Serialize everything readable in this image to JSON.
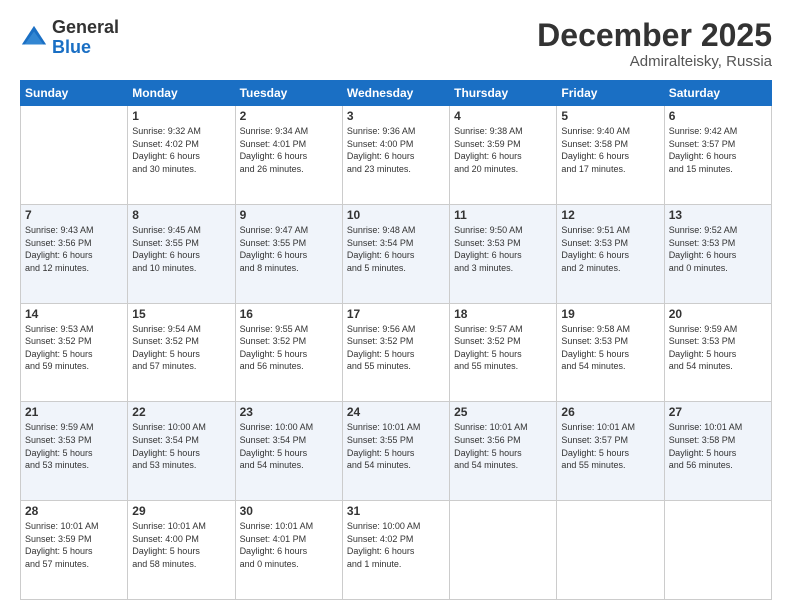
{
  "header": {
    "logo_general": "General",
    "logo_blue": "Blue",
    "month": "December 2025",
    "location": "Admiralteisky, Russia"
  },
  "days_of_week": [
    "Sunday",
    "Monday",
    "Tuesday",
    "Wednesday",
    "Thursday",
    "Friday",
    "Saturday"
  ],
  "weeks": [
    [
      {
        "day": "",
        "text": ""
      },
      {
        "day": "1",
        "text": "Sunrise: 9:32 AM\nSunset: 4:02 PM\nDaylight: 6 hours\nand 30 minutes."
      },
      {
        "day": "2",
        "text": "Sunrise: 9:34 AM\nSunset: 4:01 PM\nDaylight: 6 hours\nand 26 minutes."
      },
      {
        "day": "3",
        "text": "Sunrise: 9:36 AM\nSunset: 4:00 PM\nDaylight: 6 hours\nand 23 minutes."
      },
      {
        "day": "4",
        "text": "Sunrise: 9:38 AM\nSunset: 3:59 PM\nDaylight: 6 hours\nand 20 minutes."
      },
      {
        "day": "5",
        "text": "Sunrise: 9:40 AM\nSunset: 3:58 PM\nDaylight: 6 hours\nand 17 minutes."
      },
      {
        "day": "6",
        "text": "Sunrise: 9:42 AM\nSunset: 3:57 PM\nDaylight: 6 hours\nand 15 minutes."
      }
    ],
    [
      {
        "day": "7",
        "text": "Sunrise: 9:43 AM\nSunset: 3:56 PM\nDaylight: 6 hours\nand 12 minutes."
      },
      {
        "day": "8",
        "text": "Sunrise: 9:45 AM\nSunset: 3:55 PM\nDaylight: 6 hours\nand 10 minutes."
      },
      {
        "day": "9",
        "text": "Sunrise: 9:47 AM\nSunset: 3:55 PM\nDaylight: 6 hours\nand 8 minutes."
      },
      {
        "day": "10",
        "text": "Sunrise: 9:48 AM\nSunset: 3:54 PM\nDaylight: 6 hours\nand 5 minutes."
      },
      {
        "day": "11",
        "text": "Sunrise: 9:50 AM\nSunset: 3:53 PM\nDaylight: 6 hours\nand 3 minutes."
      },
      {
        "day": "12",
        "text": "Sunrise: 9:51 AM\nSunset: 3:53 PM\nDaylight: 6 hours\nand 2 minutes."
      },
      {
        "day": "13",
        "text": "Sunrise: 9:52 AM\nSunset: 3:53 PM\nDaylight: 6 hours\nand 0 minutes."
      }
    ],
    [
      {
        "day": "14",
        "text": "Sunrise: 9:53 AM\nSunset: 3:52 PM\nDaylight: 5 hours\nand 59 minutes."
      },
      {
        "day": "15",
        "text": "Sunrise: 9:54 AM\nSunset: 3:52 PM\nDaylight: 5 hours\nand 57 minutes."
      },
      {
        "day": "16",
        "text": "Sunrise: 9:55 AM\nSunset: 3:52 PM\nDaylight: 5 hours\nand 56 minutes."
      },
      {
        "day": "17",
        "text": "Sunrise: 9:56 AM\nSunset: 3:52 PM\nDaylight: 5 hours\nand 55 minutes."
      },
      {
        "day": "18",
        "text": "Sunrise: 9:57 AM\nSunset: 3:52 PM\nDaylight: 5 hours\nand 55 minutes."
      },
      {
        "day": "19",
        "text": "Sunrise: 9:58 AM\nSunset: 3:53 PM\nDaylight: 5 hours\nand 54 minutes."
      },
      {
        "day": "20",
        "text": "Sunrise: 9:59 AM\nSunset: 3:53 PM\nDaylight: 5 hours\nand 54 minutes."
      }
    ],
    [
      {
        "day": "21",
        "text": "Sunrise: 9:59 AM\nSunset: 3:53 PM\nDaylight: 5 hours\nand 53 minutes."
      },
      {
        "day": "22",
        "text": "Sunrise: 10:00 AM\nSunset: 3:54 PM\nDaylight: 5 hours\nand 53 minutes."
      },
      {
        "day": "23",
        "text": "Sunrise: 10:00 AM\nSunset: 3:54 PM\nDaylight: 5 hours\nand 54 minutes."
      },
      {
        "day": "24",
        "text": "Sunrise: 10:01 AM\nSunset: 3:55 PM\nDaylight: 5 hours\nand 54 minutes."
      },
      {
        "day": "25",
        "text": "Sunrise: 10:01 AM\nSunset: 3:56 PM\nDaylight: 5 hours\nand 54 minutes."
      },
      {
        "day": "26",
        "text": "Sunrise: 10:01 AM\nSunset: 3:57 PM\nDaylight: 5 hours\nand 55 minutes."
      },
      {
        "day": "27",
        "text": "Sunrise: 10:01 AM\nSunset: 3:58 PM\nDaylight: 5 hours\nand 56 minutes."
      }
    ],
    [
      {
        "day": "28",
        "text": "Sunrise: 10:01 AM\nSunset: 3:59 PM\nDaylight: 5 hours\nand 57 minutes."
      },
      {
        "day": "29",
        "text": "Sunrise: 10:01 AM\nSunset: 4:00 PM\nDaylight: 5 hours\nand 58 minutes."
      },
      {
        "day": "30",
        "text": "Sunrise: 10:01 AM\nSunset: 4:01 PM\nDaylight: 6 hours\nand 0 minutes."
      },
      {
        "day": "31",
        "text": "Sunrise: 10:00 AM\nSunset: 4:02 PM\nDaylight: 6 hours\nand 1 minute."
      },
      {
        "day": "",
        "text": ""
      },
      {
        "day": "",
        "text": ""
      },
      {
        "day": "",
        "text": ""
      }
    ]
  ]
}
